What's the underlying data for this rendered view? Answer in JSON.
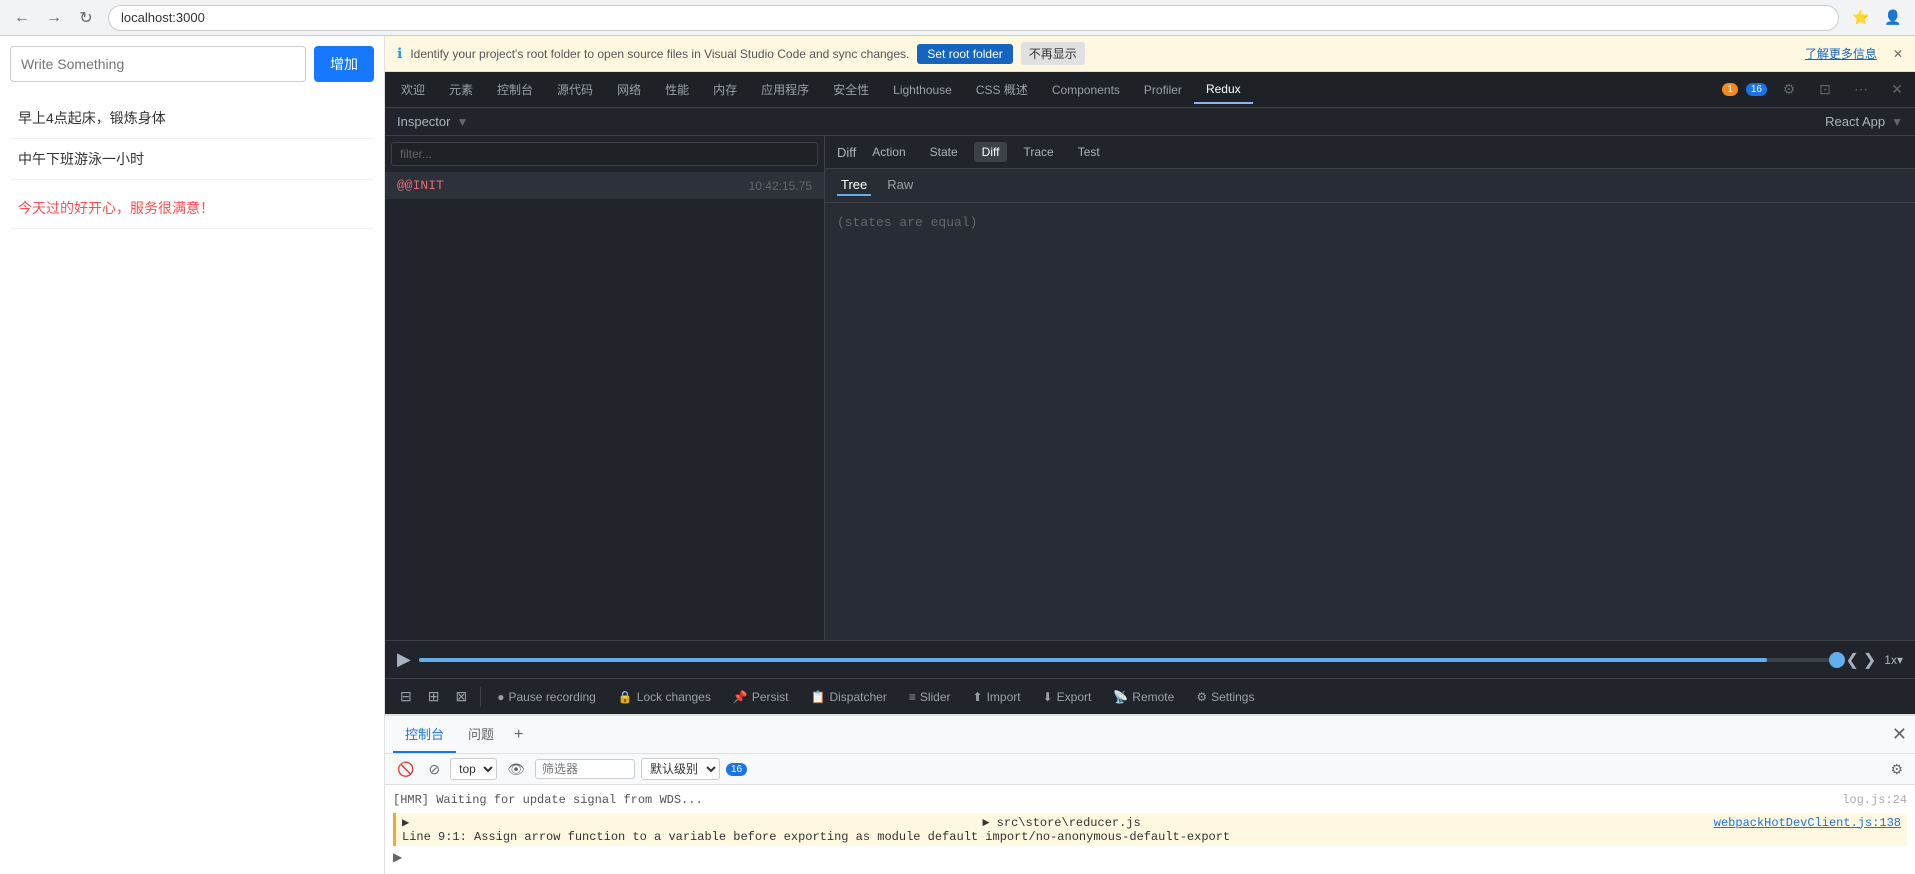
{
  "browser": {
    "url": "localhost:3000",
    "back_btn": "←",
    "forward_btn": "→",
    "reload_btn": "↻"
  },
  "info_banner": {
    "message": "Identify your project's root folder to open source files in Visual Studio Code and sync changes.",
    "set_root_label": "Set root folder",
    "dismiss_label": "不再显示",
    "learn_more": "了解更多信息",
    "close": "✕",
    "icon": "ℹ"
  },
  "devtools_tabs": {
    "tabs": [
      {
        "label": "欢迎",
        "active": false
      },
      {
        "label": "元素",
        "active": false
      },
      {
        "label": "控制台",
        "active": false
      },
      {
        "label": "源代码",
        "active": false
      },
      {
        "label": "网络",
        "active": false
      },
      {
        "label": "性能",
        "active": false
      },
      {
        "label": "内存",
        "active": false
      },
      {
        "label": "应用程序",
        "active": false
      },
      {
        "label": "安全性",
        "active": false
      },
      {
        "label": "Lighthouse",
        "active": false
      },
      {
        "label": "CSS 概述",
        "active": false
      },
      {
        "label": "Components",
        "active": false
      },
      {
        "label": "Profiler",
        "active": false
      },
      {
        "label": "Redux",
        "active": true
      }
    ],
    "warning_badge": "1",
    "blue_badge": "16"
  },
  "app": {
    "input_placeholder": "Write Something",
    "add_button": "增加",
    "items": [
      "早上4点起床，锻炼身体",
      "中午下班游泳一小时"
    ],
    "red_text": "今天过的好开心，服务很满意！"
  },
  "inspector": {
    "title": "Inspector",
    "react_app_title": "React App",
    "filter_placeholder": "filter...",
    "list_item": {
      "name": "@@INIT",
      "time": "10:42:15.75"
    }
  },
  "diff": {
    "label": "Diff",
    "buttons": [
      {
        "label": "Action",
        "active": false
      },
      {
        "label": "State",
        "active": false
      },
      {
        "label": "Diff",
        "active": true
      },
      {
        "label": "Trace",
        "active": false
      },
      {
        "label": "Test",
        "active": false
      }
    ],
    "tabs": [
      {
        "label": "Tree",
        "active": true
      },
      {
        "label": "Raw",
        "active": false
      }
    ],
    "content": "(states are equal)"
  },
  "playback": {
    "play_icon": "▶",
    "prev_icon": "❮",
    "next_icon": "❯",
    "speed": "1x",
    "dropdown": "▾"
  },
  "toolbar": {
    "icon_btns": [
      "⊟",
      "⊞",
      "⊠"
    ],
    "pause_icon": "●",
    "pause_label": "Pause recording",
    "lock_icon": "🔒",
    "lock_label": "Lock changes",
    "persist_icon": "📌",
    "persist_label": "Persist",
    "dispatcher_icon": "📋",
    "dispatcher_label": "Dispatcher",
    "slider_icon": "≡",
    "slider_label": "Slider",
    "import_icon": "⬆",
    "import_label": "Import",
    "export_icon": "⬇",
    "export_label": "Export",
    "remote_icon": "📡",
    "remote_label": "Remote",
    "settings_icon": "⚙",
    "settings_label": "Settings"
  },
  "console": {
    "tabs": [
      {
        "label": "控制台",
        "active": true
      },
      {
        "label": "问题",
        "active": false
      }
    ],
    "add_icon": "+",
    "close_icon": "✕",
    "top_label": "top",
    "filter_placeholder": "筛选器",
    "level_label": "默认级别",
    "badge": "16",
    "log_message": "[HMR] Waiting for update signal from WDS...",
    "log_file": "log.js:24",
    "warning_expand": "▶",
    "warning_file_label": "► src\\store\\reducer.js",
    "warning_line": "Line 9:1:  Assign arrow function to a variable before exporting as module default  import/no-anonymous-default-export",
    "warning_link": "webpackHotDevClient.js:138",
    "settings_icon": "⚙"
  }
}
